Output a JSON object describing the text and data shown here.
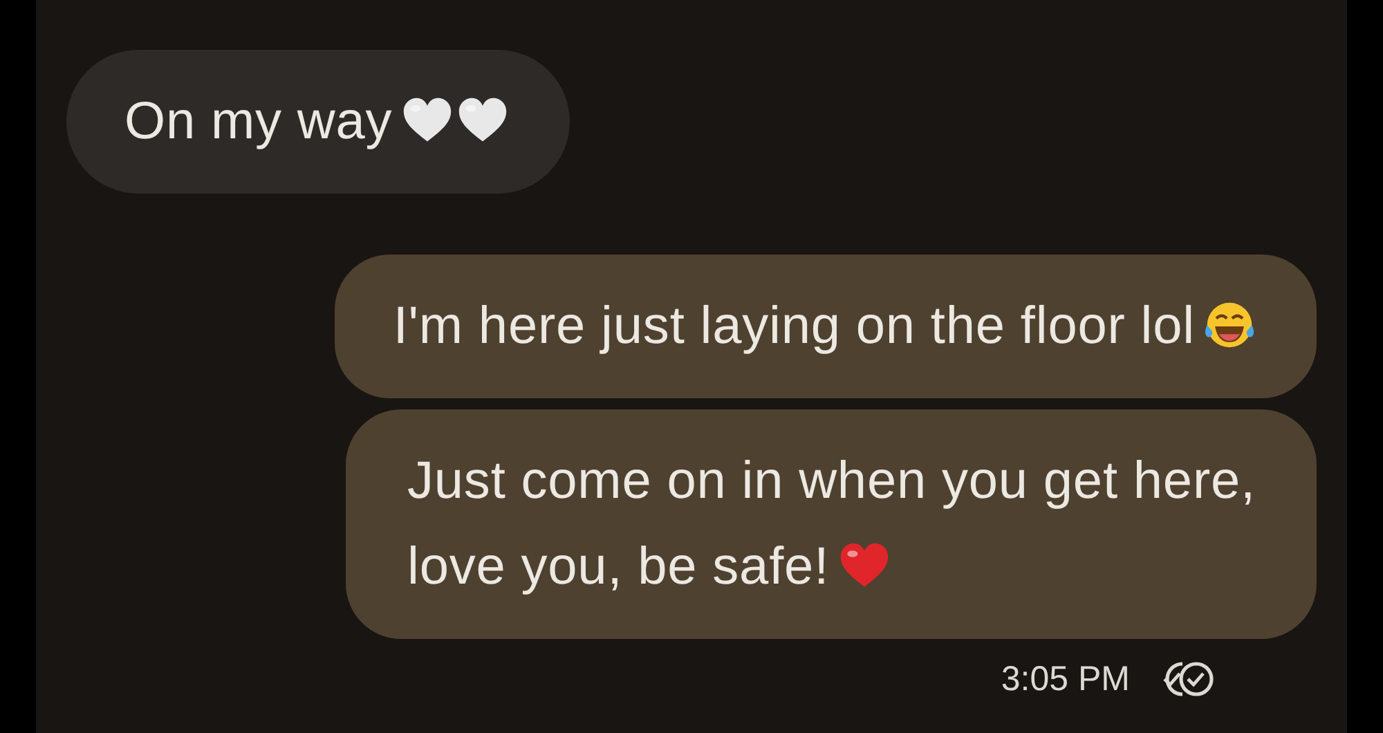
{
  "messages": [
    {
      "kind": "incoming",
      "text": "On my way",
      "emoji": [
        {
          "kind": "heart",
          "color": "#e8e8e8"
        },
        {
          "kind": "heart",
          "color": "#e8e8e8"
        }
      ]
    },
    {
      "kind": "outgoing",
      "text": "I'm here just laying on the floor lol",
      "emoji": [
        {
          "kind": "laughing"
        }
      ]
    },
    {
      "kind": "outgoing",
      "text": "Just come on in when you get here,\nlove you, be safe!",
      "emoji": [
        {
          "kind": "heart",
          "color": "#e0252b"
        }
      ]
    }
  ],
  "status": {
    "time": "3:05 PM",
    "read": true
  }
}
